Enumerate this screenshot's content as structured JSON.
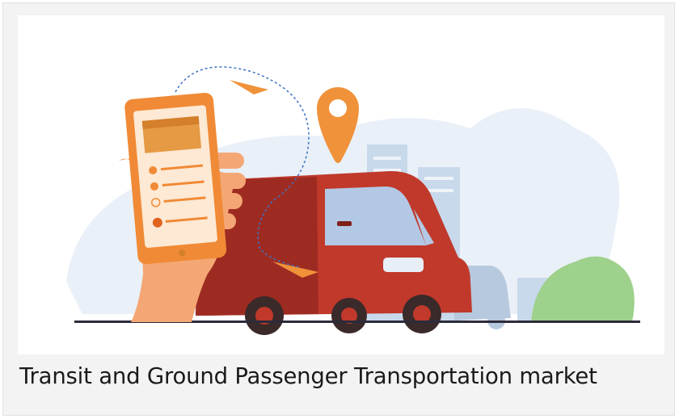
{
  "card": {
    "caption": "Transit and Ground Passenger Transportation market"
  },
  "illustration": {
    "colors": {
      "van_body": "#c0392b",
      "van_dark": "#8f231b",
      "pin": "#f0923a",
      "phone": "#f08a36",
      "hand": "#f4a774",
      "bush": "#9ed18c",
      "city": "#c9d9ec"
    }
  }
}
